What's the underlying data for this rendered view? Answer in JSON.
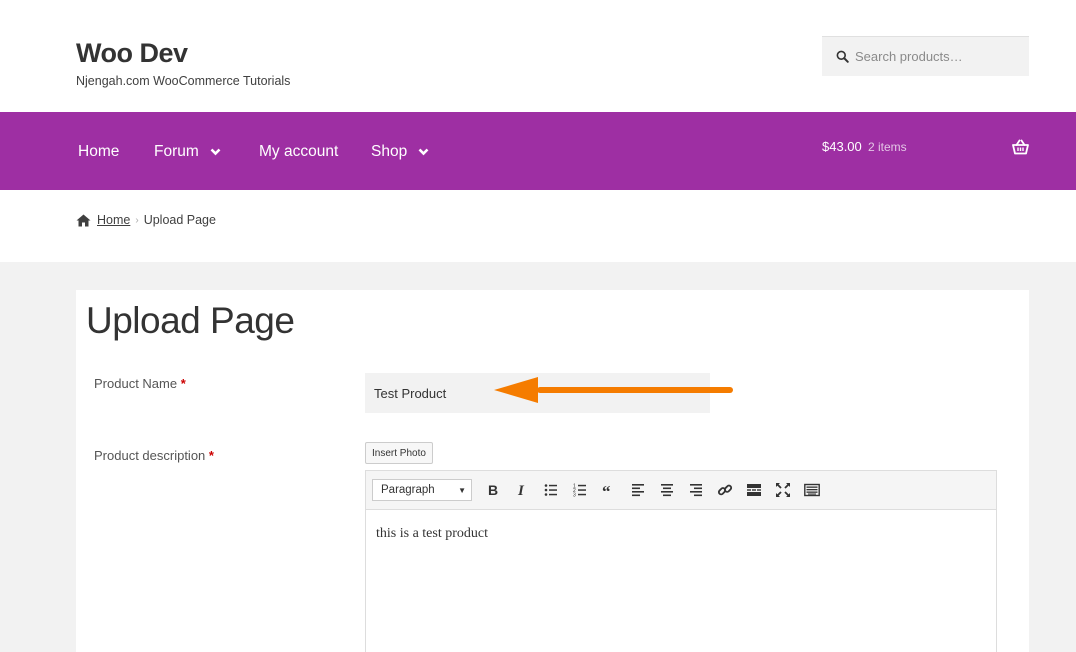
{
  "header": {
    "site_title": "Woo Dev",
    "site_description": "Njengah.com WooCommerce Tutorials",
    "search_placeholder": "Search products…"
  },
  "nav": {
    "items": [
      {
        "label": "Home",
        "has_dropdown": false
      },
      {
        "label": "Forum",
        "has_dropdown": true
      },
      {
        "label": "My account",
        "has_dropdown": false
      },
      {
        "label": "Shop",
        "has_dropdown": true
      }
    ],
    "cart_total": "$43.00",
    "cart_count": "2 items",
    "background_color": "#9e2fa3"
  },
  "breadcrumb": {
    "home": "Home",
    "current": "Upload Page"
  },
  "page": {
    "title": "Upload Page"
  },
  "form": {
    "product_name_label": "Product Name",
    "product_name_value": "Test Product",
    "product_description_label": "Product description",
    "required_marker": "*",
    "insert_photo_label": "Insert Photo",
    "format_select_value": "Paragraph",
    "editor_content": "this is a test product"
  },
  "annotation": {
    "arrow_color": "#f57c00"
  },
  "toolbar_icons": [
    "bold-icon",
    "italic-icon",
    "bullet-list-icon",
    "numbered-list-icon",
    "blockquote-icon",
    "align-left-icon",
    "align-center-icon",
    "align-right-icon",
    "link-icon",
    "read-more-icon",
    "fullscreen-icon",
    "toolbar-toggle-icon"
  ]
}
